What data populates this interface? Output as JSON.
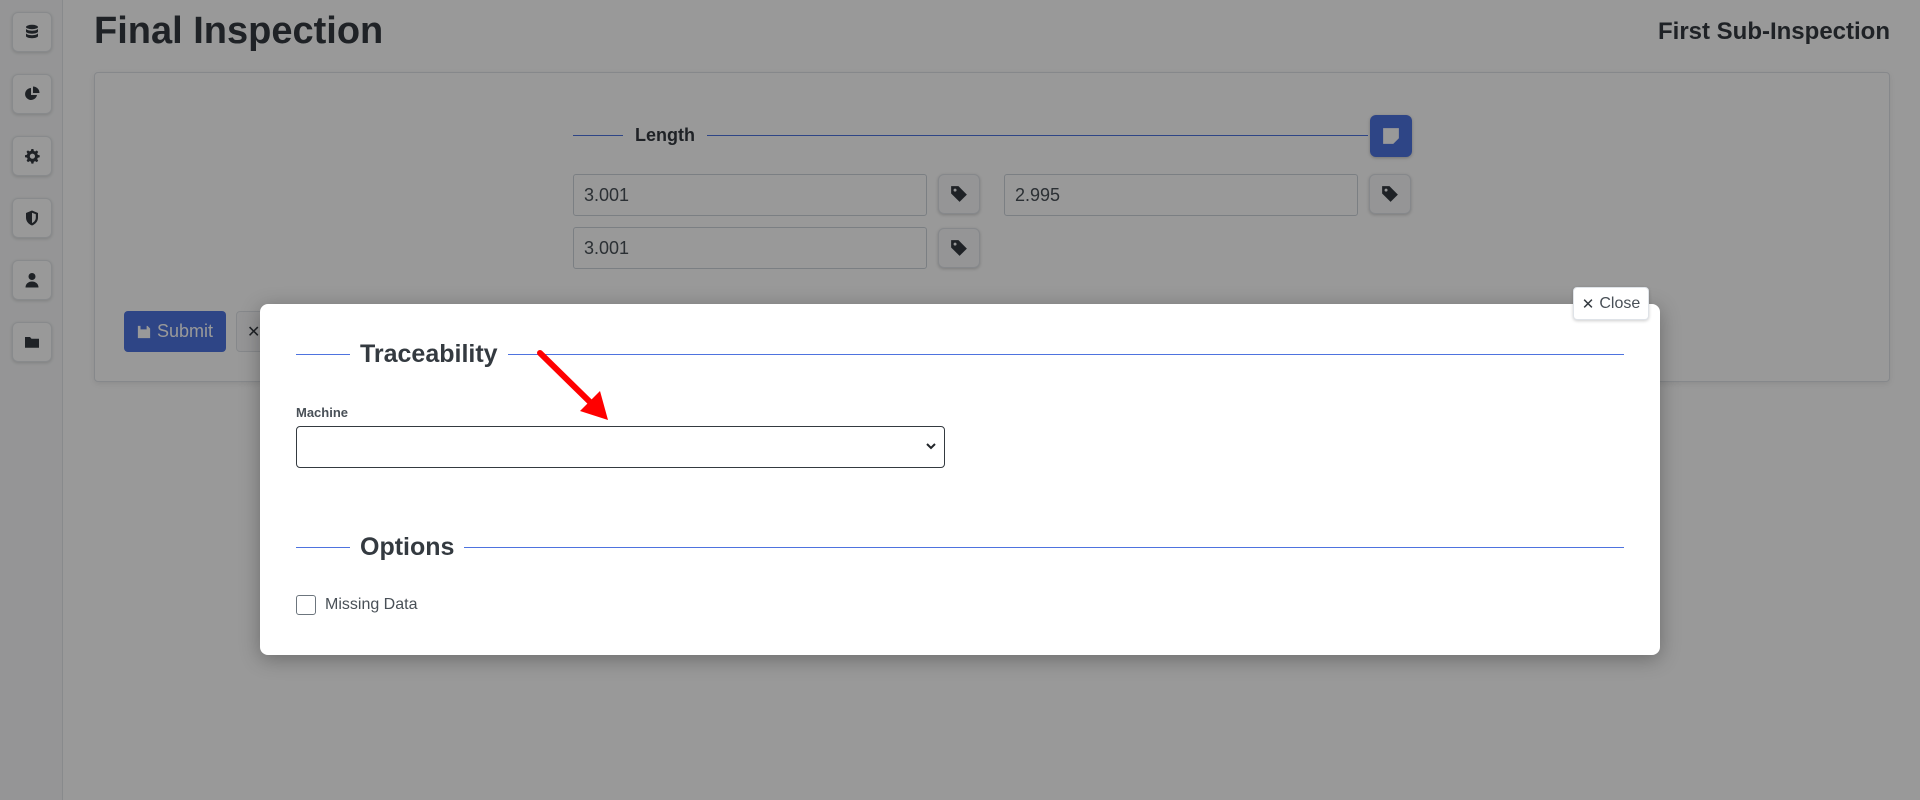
{
  "header": {
    "title": "Final Inspection",
    "subtitle": "First Sub-Inspection"
  },
  "sidebar": {
    "items": [
      {
        "icon": "database-icon"
      },
      {
        "icon": "chart-pie-icon"
      },
      {
        "icon": "gear-icon"
      },
      {
        "icon": "shield-icon"
      },
      {
        "icon": "user-icon"
      },
      {
        "icon": "folder-icon"
      }
    ]
  },
  "measurement": {
    "legend": "Length",
    "values": [
      "3.001",
      "2.995",
      "3.001"
    ]
  },
  "actions": {
    "submit_label": "Submit",
    "cancel_glyph": "✕"
  },
  "modal": {
    "close_label": "Close",
    "traceability_legend": "Traceability",
    "machine_label": "Machine",
    "machine_value": "",
    "options_legend": "Options",
    "missing_data_label": "Missing Data",
    "missing_data_checked": false
  },
  "colors": {
    "accent": "#4e73df",
    "annotation_arrow": "#ff0000"
  }
}
